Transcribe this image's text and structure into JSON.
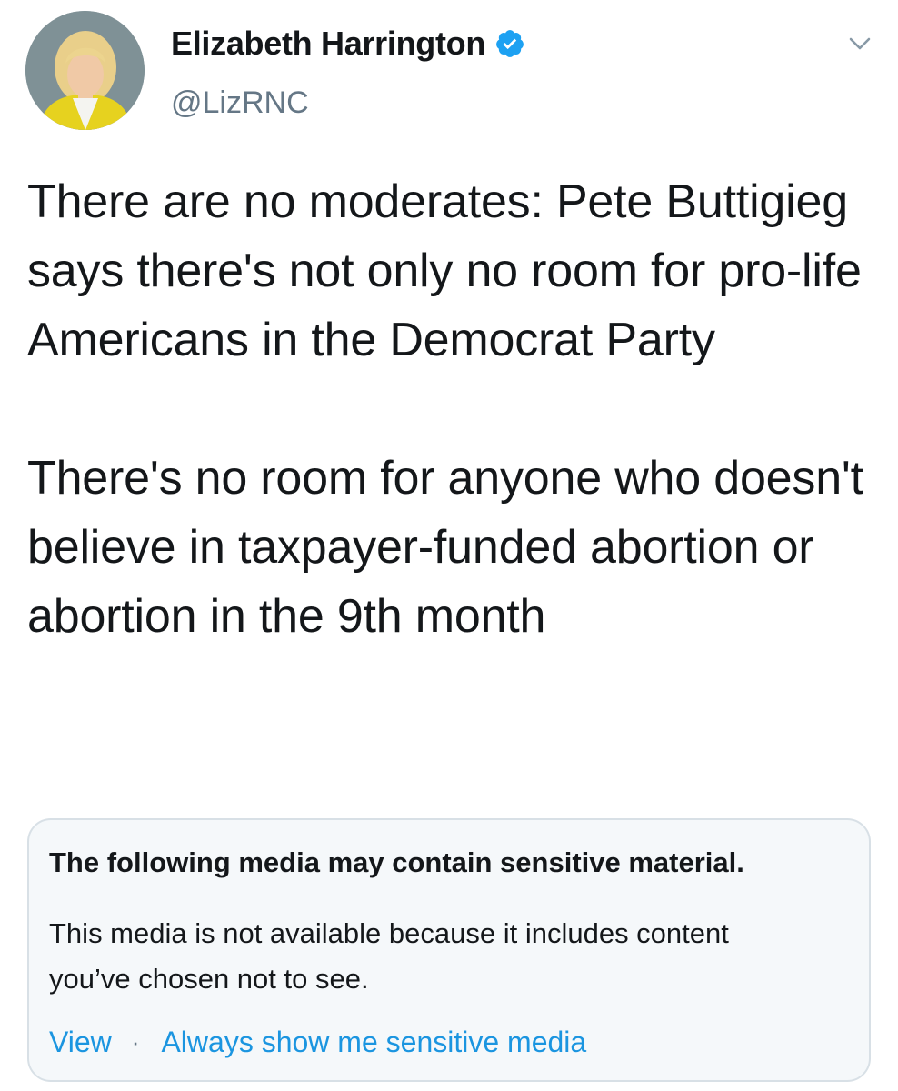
{
  "author": {
    "display_name": "Elizabeth Harrington",
    "handle": "@LizRNC",
    "verified": true,
    "verified_color": "#1da1f2"
  },
  "icons": {
    "verified": "verified-badge-icon",
    "menu": "chevron-down-icon"
  },
  "tweet": {
    "paragraphs": [
      "There are no moderates: Pete Buttigieg says there's not only no room for pro-life Americans in the Democrat Party",
      "There's no room for anyone who doesn't believe in taxpayer-funded abortion or abortion in the 9th month"
    ]
  },
  "media_notice": {
    "title": "The following media may contain sensitive material.",
    "body": "This media is not available because it includes content you’ve chosen not to see.",
    "view_label": "View",
    "separator": "·",
    "always_show_label": "Always show me sensitive media"
  },
  "colors": {
    "link": "#1b95e0",
    "secondary_text": "#657786",
    "notice_background": "#f5f8fa",
    "notice_border": "#d8e0e6"
  }
}
